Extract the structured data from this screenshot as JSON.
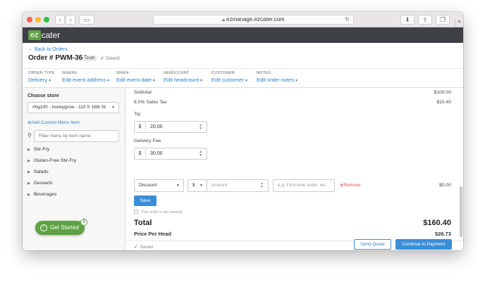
{
  "browser": {
    "url": "ezmanage.ezcater.com"
  },
  "brand": {
    "logo_ez": "ez",
    "logo_rest": "cater"
  },
  "order": {
    "back_link": "← Back to Orders",
    "title": "Order # PWM-364",
    "status_badge": "Draft",
    "saved_label": "Saved"
  },
  "meta": [
    {
      "label": "ORDER TYPE",
      "value": "Delivery"
    },
    {
      "label": "WHERE",
      "value": "Edit event address"
    },
    {
      "label": "WHEN",
      "value": "Edit event date"
    },
    {
      "label": "HEADCOUNT",
      "value": "Edit headcount"
    },
    {
      "label": "CUSTOMER",
      "value": "Edit customer"
    },
    {
      "label": "NOTES",
      "value": "Edit order notes"
    }
  ],
  "sidebar": {
    "choose_store_label": "Choose store",
    "store_value": "#hg100 - honeygrow - 110 S 16th St",
    "add_custom_label": "Add Custom Menu Item",
    "filter_placeholder": "Filter menu by item name",
    "categories": [
      "Stir-Fry",
      "Gluten-Free Stir-Fry",
      "Salads",
      "Desserts",
      "Beverages"
    ],
    "get_started_label": "Get Started",
    "get_started_count": "3"
  },
  "summary": {
    "subtotal_label": "Subtotal",
    "subtotal_value": "$100.00",
    "tax_label": "8.0% Sales Tax",
    "tax_value": "$10.40",
    "tip_label": "Tip",
    "tip_currency": "$",
    "tip_value": "20.00",
    "delivery_label": "Delivery Fee",
    "delivery_currency": "$",
    "delivery_value": "30.00",
    "discount_type": "Discount",
    "discount_unit": "$",
    "amount_placeholder": "Amount",
    "reason_placeholder": "e.g. First time order, etc.",
    "remove_label": "Remove",
    "discount_value": "$0.00",
    "save_label": "Save",
    "tax_exempt_label": "This order is tax exempt.",
    "total_label": "Total",
    "total_value": "$160.40",
    "pph_label": "Price Per Head",
    "pph_value": "$26.73"
  },
  "footer": {
    "saved_label": "Saved",
    "send_quote_label": "Send Quote",
    "continue_label": "Continue to Payment"
  }
}
